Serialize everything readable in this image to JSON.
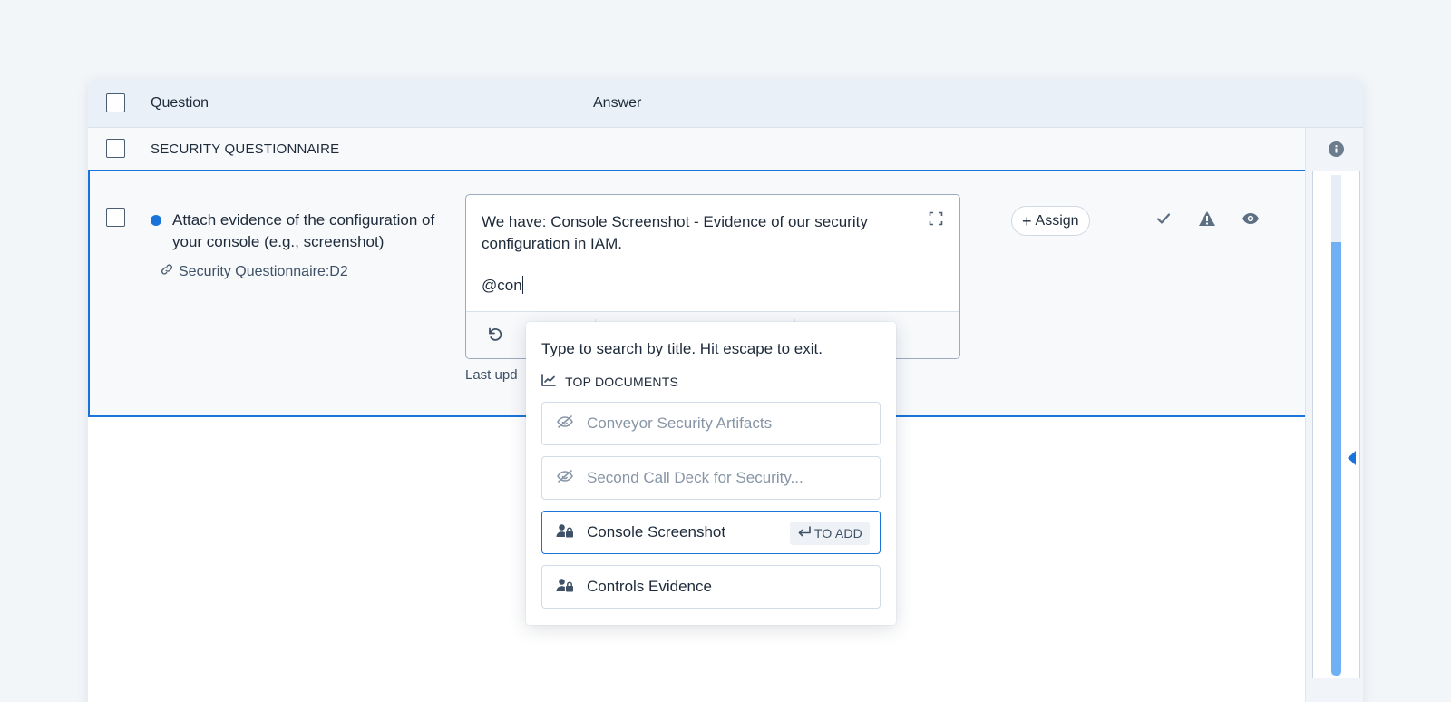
{
  "table": {
    "header": {
      "question_label": "Question",
      "answer_label": "Answer"
    },
    "section": {
      "title": "SECURITY QUESTIONNAIRE"
    }
  },
  "question": {
    "text": "Attach evidence of the configuration of your console (e.g., screenshot)",
    "reference": "Security Questionnaire:D2",
    "status_color": "#1a73d9"
  },
  "answer": {
    "text": "We have: Console Screenshot - Evidence of our security configuration in IAM.",
    "mention_input": "@con",
    "last_updated": "Last upd"
  },
  "actions": {
    "assign_label": "Assign",
    "icons": [
      "check-icon",
      "warning-icon",
      "eye-icon"
    ]
  },
  "mention_popover": {
    "hint": "Type to search by title. Hit escape to exit.",
    "section_label": "TOP DOCUMENTS",
    "items": [
      {
        "label": "Conveyor Security Artifacts",
        "icon": "eye-off-icon",
        "state": "disabled"
      },
      {
        "label": "Second Call Deck for Security...",
        "icon": "eye-off-icon",
        "state": "disabled"
      },
      {
        "label": "Console Screenshot",
        "icon": "user-lock-icon",
        "state": "selected",
        "badge": "TO ADD"
      },
      {
        "label": "Controls Evidence",
        "icon": "user-lock-icon",
        "state": "normal"
      }
    ]
  },
  "colors": {
    "accent": "#1a73d9",
    "scroll_thumb": "#6fb0f5"
  }
}
